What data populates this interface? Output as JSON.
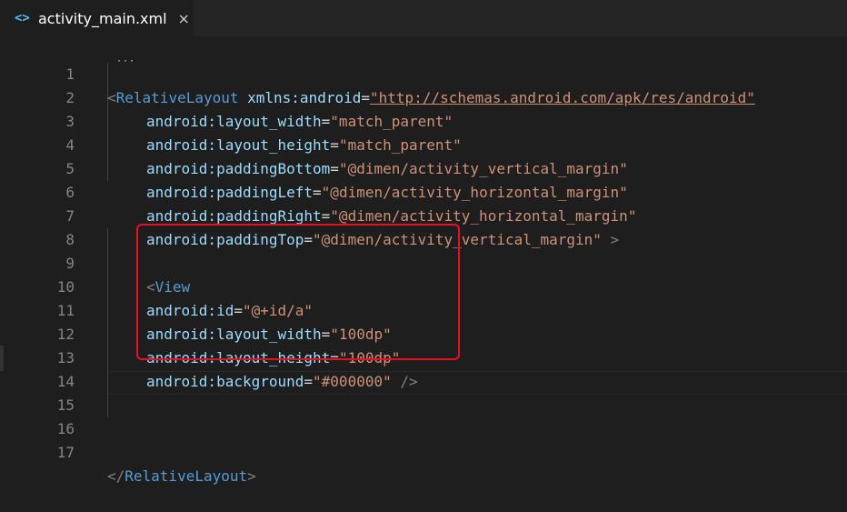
{
  "tab": {
    "icon": "code-xml-icon",
    "title": "activity_main.xml",
    "close": "×"
  },
  "editor": {
    "lines": [
      {
        "num": "1",
        "parts": {
          "p1": "<",
          "p2": "RelativeLayout",
          "p3": " xmlns:android",
          "p4": "=",
          "p5": "\"http://schemas.android.com/apk/res/android\""
        }
      },
      {
        "num": "2",
        "parts": {
          "p1": "android:layout_width",
          "p2": "=",
          "p3": "\"match_parent\""
        }
      },
      {
        "num": "3",
        "parts": {
          "p1": "android:layout_height",
          "p2": "=",
          "p3": "\"match_parent\""
        }
      },
      {
        "num": "4",
        "parts": {
          "p1": "android:paddingBottom",
          "p2": "=",
          "p3": "\"@dimen/activity_vertical_margin\""
        }
      },
      {
        "num": "5",
        "parts": {
          "p1": "android:paddingLeft",
          "p2": "=",
          "p3": "\"@dimen/activity_horizontal_margin\""
        }
      },
      {
        "num": "6",
        "parts": {
          "p1": "android:paddingRight",
          "p2": "=",
          "p3": "\"@dimen/activity_horizontal_margin\""
        }
      },
      {
        "num": "7",
        "parts": {
          "p1": "android:paddingTop",
          "p2": "=",
          "p3": "\"@dimen/activity_vertical_margin\"",
          "p4": " >"
        }
      },
      {
        "num": "8"
      },
      {
        "num": "9",
        "parts": {
          "p1": "<",
          "p2": "View"
        }
      },
      {
        "num": "10",
        "parts": {
          "p1": "android:id",
          "p2": "=",
          "p3": "\"@+id/a\""
        }
      },
      {
        "num": "11",
        "parts": {
          "p1": "android:layout_width",
          "p2": "=",
          "p3": "\"100dp\""
        }
      },
      {
        "num": "12",
        "parts": {
          "p1": "android:layout_height",
          "p2": "=",
          "p3": "\"100dp\""
        }
      },
      {
        "num": "13",
        "parts": {
          "p1": "android:background",
          "p2": "=",
          "p3": "\"#000000\"",
          "p4": " />"
        }
      },
      {
        "num": "14"
      },
      {
        "num": "15"
      },
      {
        "num": "16"
      },
      {
        "num": "17",
        "parts": {
          "p1": "</",
          "p2": "RelativeLayout",
          "p3": ">"
        }
      }
    ]
  },
  "colors": {
    "highlight_box": "#e81123",
    "tag": "#569cd6",
    "attr": "#9cdcfe",
    "value": "#ce9178"
  }
}
